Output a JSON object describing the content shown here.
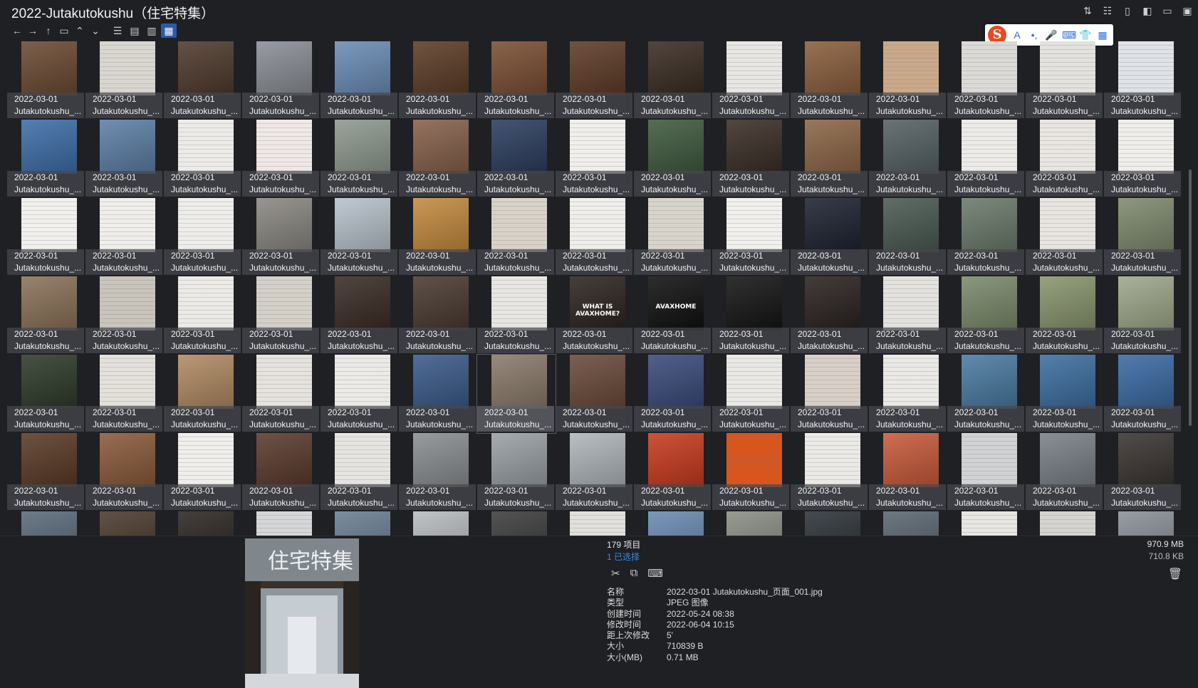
{
  "window": {
    "title": "2022-Jutakutokushu（住宅特集）"
  },
  "window_buttons": [
    "sort-icon",
    "tree-view-icon",
    "document-icon",
    "panel-left-icon",
    "panel-preview-icon",
    "clipboard-icon"
  ],
  "toolbar": {
    "nav": [
      {
        "name": "back-button",
        "icon": "←"
      },
      {
        "name": "forward-button",
        "icon": "→"
      },
      {
        "name": "up-button",
        "icon": "↑"
      },
      {
        "name": "folder-button",
        "icon": "▭"
      },
      {
        "name": "expand-up-button",
        "icon": "⌃"
      },
      {
        "name": "expand-down-button",
        "icon": "⌄"
      }
    ],
    "views": [
      {
        "name": "list-view-button",
        "icon": "☰",
        "active": false
      },
      {
        "name": "details-view-button",
        "icon": "▤",
        "active": false
      },
      {
        "name": "tiles-view-button",
        "icon": "▥",
        "active": false
      },
      {
        "name": "thumbnail-view-button",
        "icon": "▦",
        "active": true
      }
    ]
  },
  "ime_bar": {
    "logo": "S",
    "items": [
      "A",
      "•,",
      "🎤",
      "⌨",
      "👕",
      "▦"
    ]
  },
  "files": {
    "date_label": "2022-03-01",
    "name_label": "Jutakutokushu_...",
    "selected_index": 66,
    "thumb_colors": [
      "#6b4a32",
      "#d9d6d0",
      "#4e3a2c",
      "#8a8f96",
      "#6a8cb6",
      "#5c3c26",
      "#7a4e33",
      "#5e3b27",
      "#3a2c22",
      "#e8e6e2",
      "#8a5e3c",
      "#caa98a",
      "#dcdad6",
      "#e4e2de",
      "#dfe2e6",
      "#3d6ea8",
      "#5d7fa6",
      "#ecebe8",
      "#efe8e6",
      "#8e9a8e",
      "#86604a",
      "#2b3d5e",
      "#f0efeb",
      "#3f5a3e",
      "#3a2e26",
      "#8b6646",
      "#556063",
      "#ecebe8",
      "#e9e6e2",
      "#efeeea",
      "#f1f0ed",
      "#efeeeb",
      "#eeedea",
      "#8a8781",
      "#b8c2cc",
      "#c48a3e",
      "#d8d2c8",
      "#efeeea",
      "#d8d4cc",
      "#f1f0ed",
      "#1c2230",
      "#4a5a52",
      "#6a7a6a",
      "#e8e4e0",
      "#7e8a6e",
      "#8a7258",
      "#c9c4bc",
      "#eceae6",
      "#d4d0c8",
      "#3a2c24",
      "#4a3a30",
      "#e8e6e2",
      "#2c2420",
      "#101010",
      "#141414",
      "#2a2220",
      "#e4e2de",
      "#7a8a6a",
      "#88956e",
      "#9ea88a",
      "#2e3a2a",
      "#e4e0da",
      "#b08a62",
      "#e6e3de",
      "#eceae6",
      "#3a5a8a",
      "#8a7a6a",
      "#6a4a3a",
      "#3a4a7a",
      "#e9e8e4",
      "#d8d0c8",
      "#ebe9e5",
      "#4a7aa2",
      "#3c6ea0",
      "#3a6aa4",
      "#5a3a26",
      "#8a5a3a",
      "#efeeeb",
      "#5a3a2c",
      "#e6e4e0",
      "#8a8e90",
      "#9aa0a6",
      "#b0b6bc",
      "#c83a1e",
      "#d8551e",
      "#eceae6",
      "#c85a3a",
      "#d0d2d4",
      "#7a8088",
      "#3a3430",
      "#5a6a7a",
      "#4a3a2e",
      "#2c2622",
      "#d4d6d8",
      "#6a7e94",
      "#b8bcc0",
      "#3c3c3c",
      "#e2e0dc",
      "#6a8ab0",
      "#8a8e82",
      "#2c3238",
      "#5a6670",
      "#e8e6e2",
      "#d6d4d0",
      "#8a9098"
    ],
    "special_text": {
      "52": "WHAT IS AVAXHOME?",
      "53": "AVAXHOME"
    }
  },
  "status": {
    "count": "179 项目",
    "selected": "1 已选择",
    "total_size": "970.9 MB",
    "selected_size": "710.8 KB"
  },
  "actions": [
    "cut-icon",
    "copy-icon",
    "rename-icon"
  ],
  "properties": [
    {
      "key": "名称",
      "value": "2022-03-01 Jutakutokushu_页面_001.jpg"
    },
    {
      "key": "类型",
      "value": "JPEG 图像"
    },
    {
      "key": "创建时间",
      "value": "2022-05-24  08:38"
    },
    {
      "key": "修改时间",
      "value": "2022-06-04  10:15"
    },
    {
      "key": "距上次修改",
      "value": "5'"
    },
    {
      "key": "大小",
      "value": "710839 B"
    },
    {
      "key": "大小(MB)",
      "value": "0.71 MB"
    }
  ],
  "preview": {
    "cover_title": "住宅特集"
  }
}
